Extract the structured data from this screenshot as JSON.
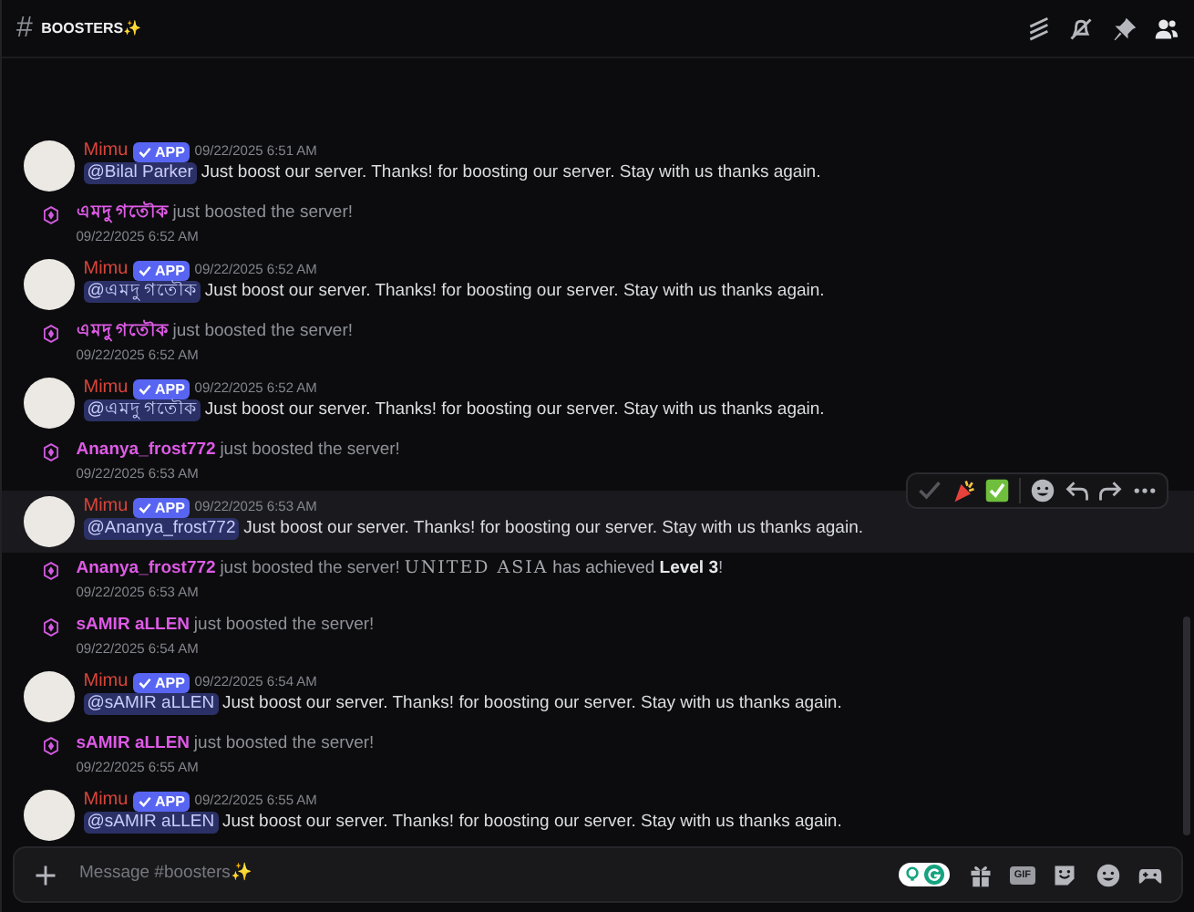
{
  "channel": {
    "hash": "#",
    "name": "BOOSTERS✨"
  },
  "messages": [
    {
      "kind": "bot",
      "author": "Mimu",
      "badge": "APP",
      "time": "09/22/2025 6:51 AM",
      "mention": "@Bilal Parker",
      "text": "Just boost our server. Thanks! for boosting our server. Stay with us thanks again.",
      "highlighted": false
    },
    {
      "kind": "boost",
      "user": "এমদু গতৌক",
      "text": "just boosted the server!",
      "time": "09/22/2025 6:52 AM"
    },
    {
      "kind": "bot",
      "author": "Mimu",
      "badge": "APP",
      "time": "09/22/2025 6:52 AM",
      "mention": "@এমদু গতৌক",
      "text": "Just boost our server. Thanks! for boosting our server. Stay with us thanks again.",
      "highlighted": false
    },
    {
      "kind": "boost",
      "user": "এমদু গতৌক",
      "text": "just boosted the server!",
      "time": "09/22/2025 6:52 AM"
    },
    {
      "kind": "bot",
      "author": "Mimu",
      "badge": "APP",
      "time": "09/22/2025 6:52 AM",
      "mention": "@এমদু গতৌক",
      "text": "Just boost our server. Thanks! for boosting our server. Stay with us thanks again.",
      "highlighted": false
    },
    {
      "kind": "boost",
      "user": "Ananya_frost772",
      "text": "just boosted the server!",
      "time": "09/22/2025 6:53 AM"
    },
    {
      "kind": "bot",
      "author": "Mimu",
      "badge": "APP",
      "time": "09/22/2025 6:53 AM",
      "mention": "@Ananya_frost772",
      "text": "Just boost our server. Thanks! for boosting our server. Stay with us thanks again.",
      "highlighted": true
    },
    {
      "kind": "boost",
      "user": "Ananya_frost772",
      "text": "just boosted the server!",
      "server": "UNITED ASIA",
      "tail": "has achieved **Level 3**!",
      "time": "09/22/2025 6:53 AM"
    },
    {
      "kind": "boost",
      "user": "sAMIR aLLEN",
      "text": "just boosted the server!",
      "time": "09/22/2025 6:54 AM"
    },
    {
      "kind": "bot",
      "author": "Mimu",
      "badge": "APP",
      "time": "09/22/2025 6:54 AM",
      "mention": "@sAMIR aLLEN",
      "text": "Just boost our server. Thanks! for boosting our server. Stay with us thanks again.",
      "highlighted": false
    },
    {
      "kind": "boost",
      "user": "sAMIR aLLEN",
      "text": "just boosted the server!",
      "time": "09/22/2025 6:55 AM"
    },
    {
      "kind": "bot",
      "author": "Mimu",
      "badge": "APP",
      "time": "09/22/2025 6:55 AM",
      "mention": "@sAMIR aLLEN",
      "text": "Just boost our server. Thanks! for boosting our server. Stay with us thanks again.",
      "highlighted": false
    }
  ],
  "composer": {
    "placeholder": "Message #boosters✨",
    "gif_label": "GIF"
  }
}
